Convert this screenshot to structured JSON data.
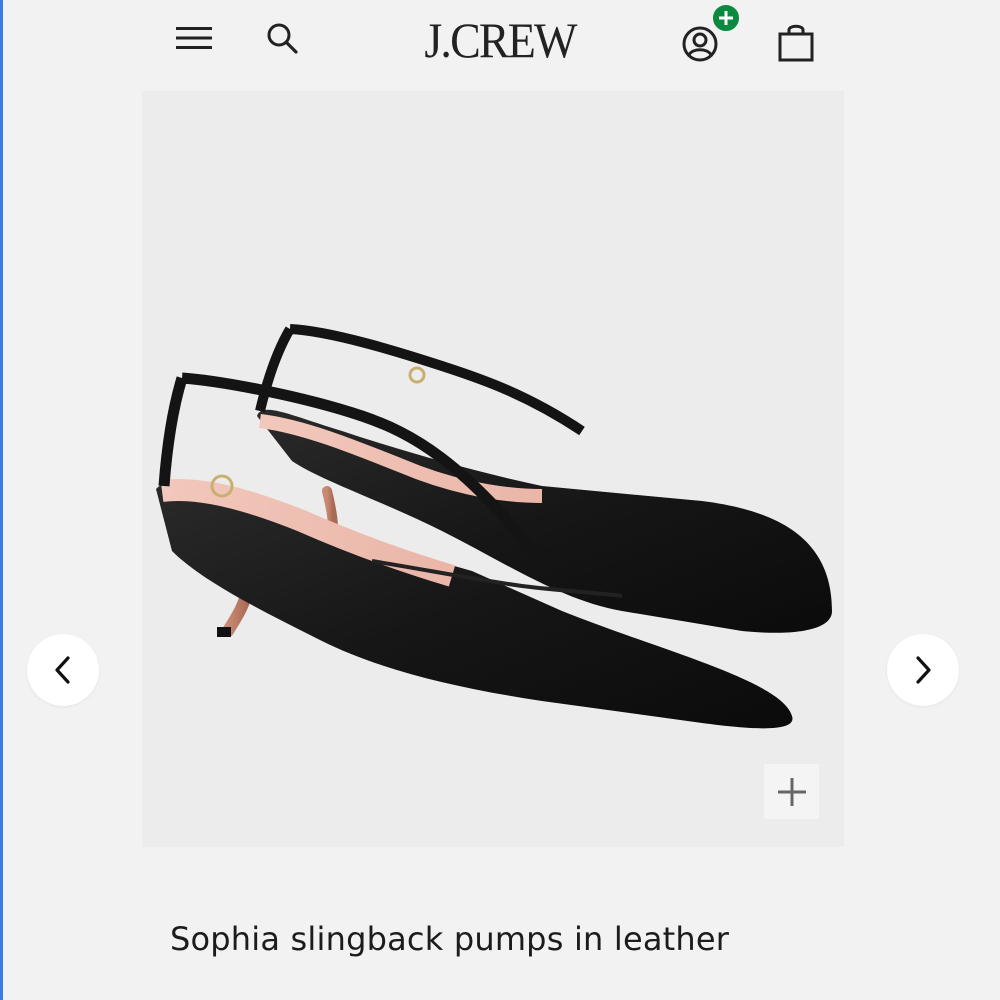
{
  "header": {
    "logo_text": "J.CREW",
    "menu_icon": "hamburger-menu-icon",
    "search_icon": "search-icon",
    "account_icon": "user-account-icon",
    "account_badge": "+",
    "account_badge_color": "#0a8a3e",
    "bag_icon": "shopping-bag-icon"
  },
  "gallery": {
    "prev_icon": "chevron-left-icon",
    "next_icon": "chevron-right-icon",
    "zoom_symbol": "+",
    "image_subject": "black leather slingback kitten-heel pumps"
  },
  "product": {
    "title": "Sophia slingback pumps in leather"
  },
  "colors": {
    "background": "#f2f2f2",
    "text": "#1c1c1c",
    "accent_edge": "#3b7de0"
  }
}
